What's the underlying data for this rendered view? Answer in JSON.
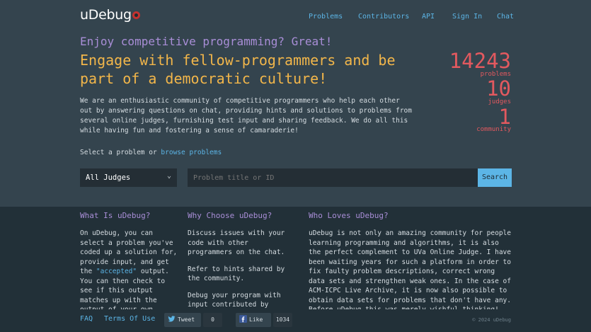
{
  "header": {
    "logo": "uDebug",
    "nav": [
      "Problems",
      "Contributors",
      "API",
      "Sign In",
      "Chat"
    ]
  },
  "hero": {
    "tagline": "Enjoy competitive programming? Great!",
    "headline": "Engage with fellow-programmers and be part of a democratic culture!",
    "intro": "We are an enthusiastic community of competitive programmers who help each other out by answering questions on chat, providing hints and solutions to problems from several online judges, furnishing test input and sharing feedback. We do all this while having fun and fostering a sense of camaraderie!"
  },
  "stats": [
    {
      "value": "14243",
      "label": "problems"
    },
    {
      "value": "10",
      "label": "judges"
    },
    {
      "value": "1",
      "label": "community"
    }
  ],
  "search": {
    "prompt": "Select a problem or",
    "browse_link": "browse problems",
    "judge_selected": "All Judges",
    "placeholder": "Problem title or ID",
    "button": "Search"
  },
  "columns": [
    {
      "title": "What Is uDebug?",
      "p1": "On uDebug, you can select a problem you've coded up a solution for, provide input, and get the",
      "hl": "\"accepted\"",
      "p1b": "output. You can then check to see if this output matches up with the output of your own"
    },
    {
      "title": "Why Choose uDebug?",
      "p1": "Discuss issues with your code with other programmers on the chat.",
      "p2": "Refer to hints shared by the community.",
      "p3": "Debug your program with input contributed by"
    },
    {
      "title": "Who Loves uDebug?",
      "p1": "uDebug is not only an amazing community for people learning programming and algorithms, it is also the perfect complement to UVa Online Judge. I have been waiting years for such a platform in order to fix faulty problem descriptions, correct wrong data sets and strengthen weak ones. In the case of ACM-ICPC Live Archive, it is now also possible to obtain data sets for problems that don't have any. Before uDebug this was merely wishful thinking!"
    }
  ],
  "footer": {
    "faq": "FAQ",
    "terms": "Terms Of Use",
    "tweet": "Tweet",
    "tweet_count": "0",
    "like": "Like",
    "like_count": "1034",
    "copyright": "© 2024 uDebug"
  }
}
